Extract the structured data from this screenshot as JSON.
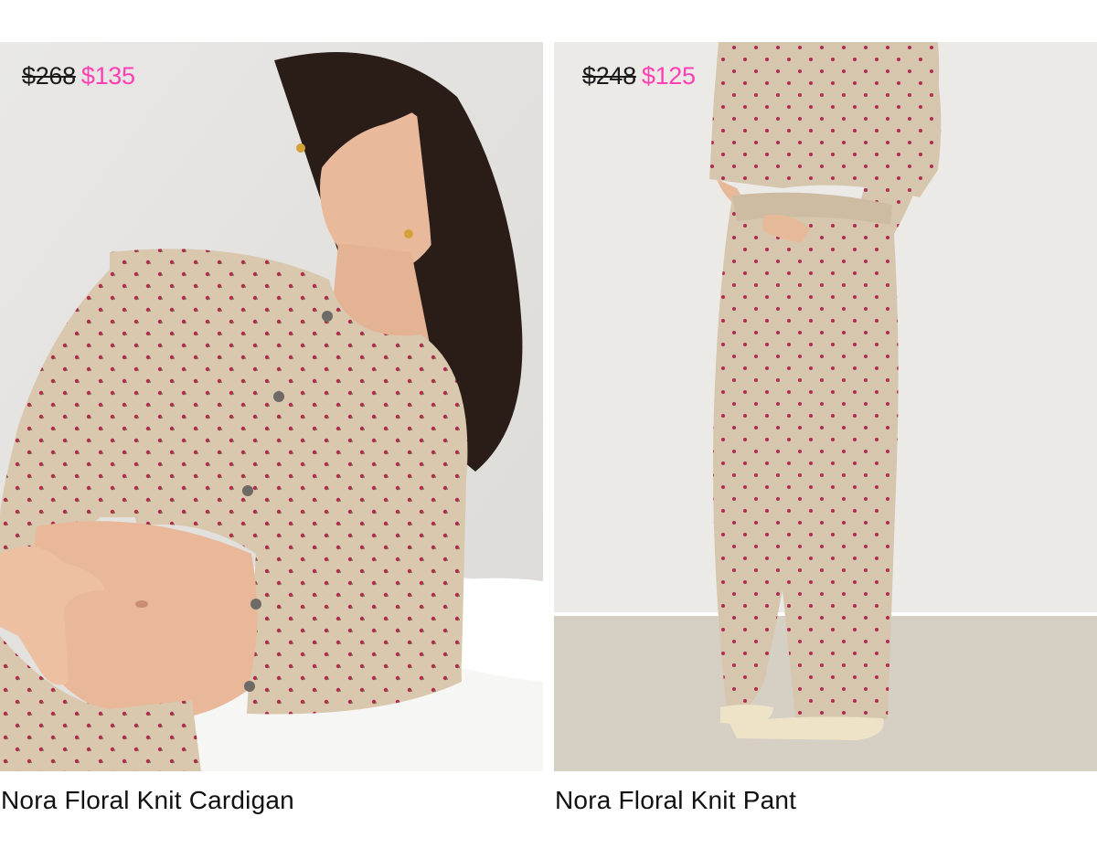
{
  "products": [
    {
      "name": "Nora Floral Knit Cardigan",
      "original_price": "$268",
      "sale_price": "$135",
      "image": "model-in-cardigan-photo"
    },
    {
      "name": "Nora Floral Knit Pant",
      "original_price": "$248",
      "sale_price": "$125",
      "image": "model-in-pant-photo"
    }
  ],
  "colors": {
    "sale_price": "#ff3fb4",
    "original_price": "#1a1a1a",
    "product_name": "#111111",
    "knit_fabric": "#d8c7ad",
    "floral_dot": "#b22a4f"
  }
}
